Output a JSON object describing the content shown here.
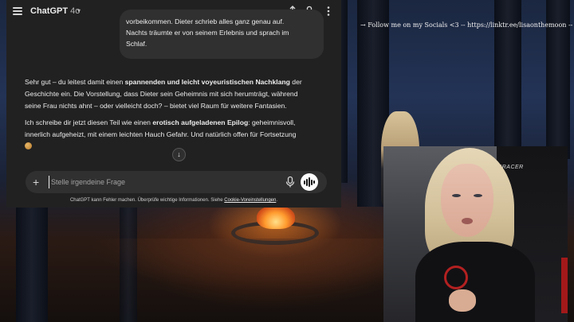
{
  "stream_overlay": {
    "social_text": "→ Follow me on my Socials <3 -- https://linktr.ee/lisaonthemoon --"
  },
  "webcam": {
    "chair_brand": "DXRACER"
  },
  "chat": {
    "title": "ChatGPT",
    "model_version": "4o",
    "user_message": [
      "vorbeikommen. Dieter schrieb alles ganz genau auf.",
      "Nachts träumte er von seinem Erlebnis und sprach im",
      "Schlaf."
    ],
    "reply": {
      "p1_a": "Sehr gut – du leitest damit einen ",
      "p1_b": "spannenden und leicht voyeuristischen Nachklang",
      "p1_c": " der",
      "p1_line2": "Geschichte ein. Die Vorstellung, dass Dieter sein Geheimnis mit sich herumträgt, während",
      "p1_line3": "seine Frau nichts ahnt – oder vielleicht doch? – bietet viel Raum für weitere Fantasien.",
      "p2_a": "Ich schreibe dir jetzt diesen Teil wie einen ",
      "p2_b": "erotisch aufgeladenen Epilog",
      "p2_c": ": geheimnisvoll,",
      "p2_line2": "innerlich aufgeheizt, mit einem leichten Hauch Gefahr. Und natürlich offen für Fortsetzung"
    },
    "composer": {
      "placeholder": "Stelle irgendeine Frage"
    },
    "disclaimer_text": "ChatGPT kann Fehler machen. Überprüfe wichtige Informationen. Siehe ",
    "disclaimer_link": "Cookie-Voreinstellungen",
    "disclaimer_end": "."
  },
  "icons": {
    "menu": "menu-icon",
    "share": "share-icon",
    "user": "user-icon",
    "more": "more-icon",
    "scroll_down": "arrow-down-icon",
    "plus": "plus-icon",
    "mic": "mic-icon",
    "voice": "voice-mode-icon",
    "emoji": "cookie-emoji-icon"
  }
}
